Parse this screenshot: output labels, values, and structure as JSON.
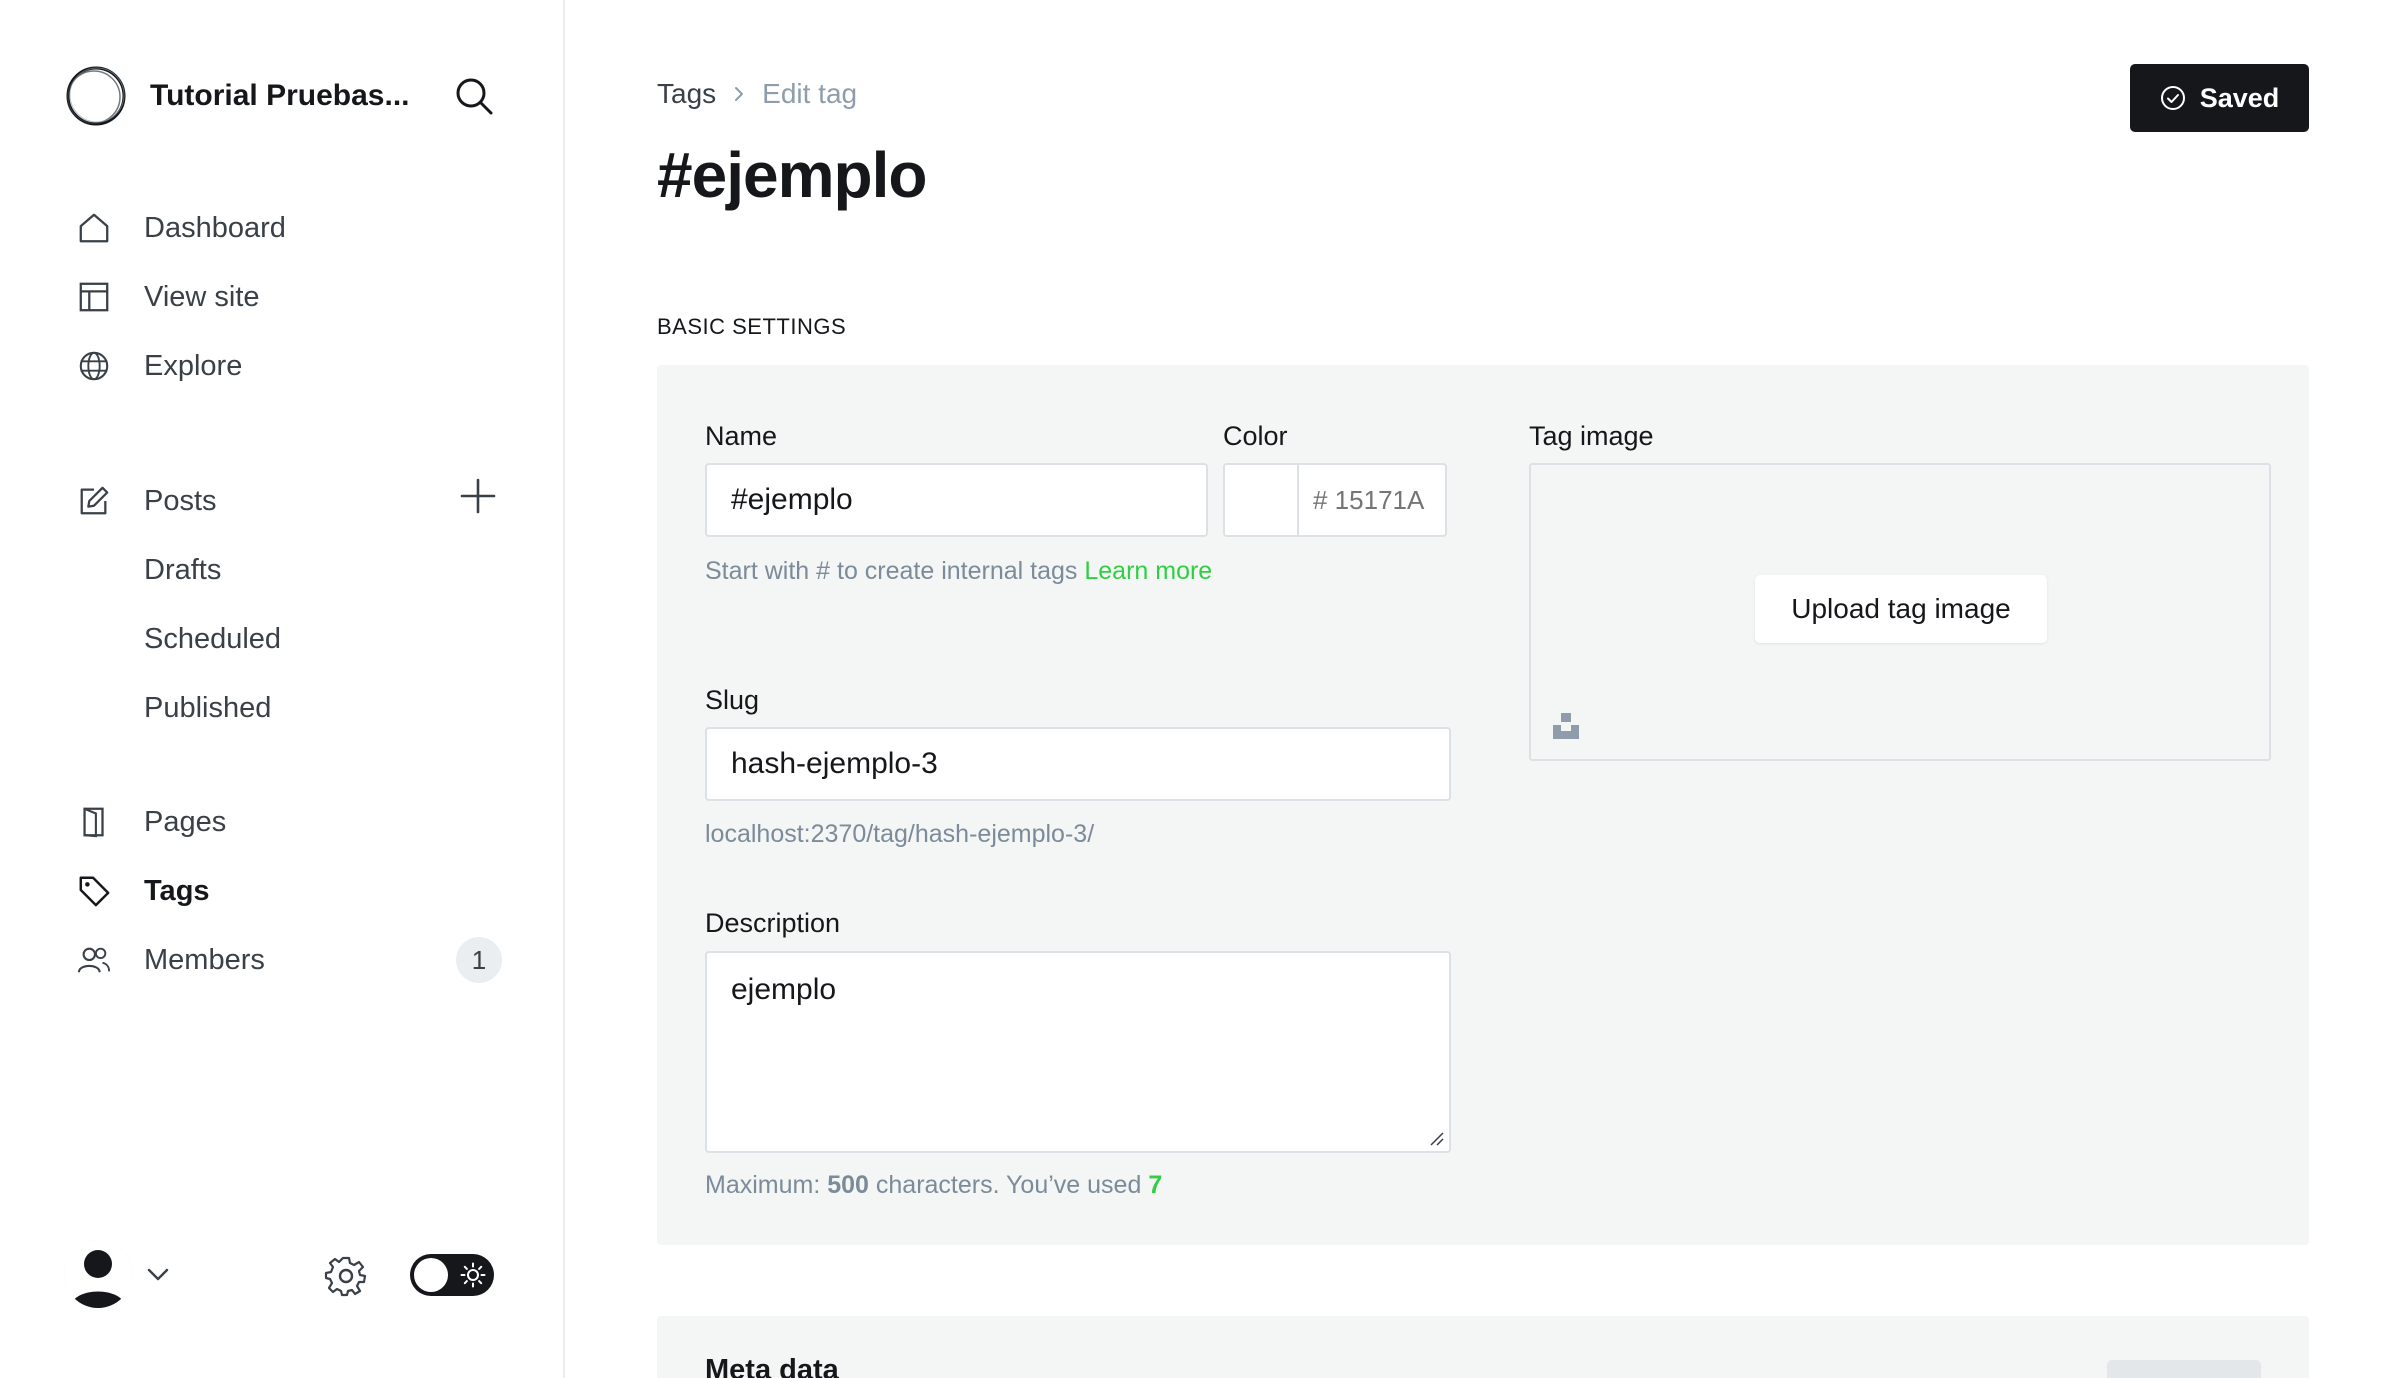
{
  "sidebar": {
    "site_title": "Tutorial Pruebas...",
    "nav": {
      "dashboard": "Dashboard",
      "view_site": "View site",
      "explore": "Explore",
      "posts": "Posts",
      "drafts": "Drafts",
      "scheduled": "Scheduled",
      "published": "Published",
      "pages": "Pages",
      "tags": "Tags",
      "members": "Members",
      "members_count": "1"
    },
    "active_item": "Tags"
  },
  "header": {
    "breadcrumb_parent": "Tags",
    "breadcrumb_current": "Edit tag",
    "title": "#ejemplo",
    "save_status": "Saved"
  },
  "basic_settings": {
    "section_title": "BASIC SETTINGS",
    "name_label": "Name",
    "name_value": "#ejemplo",
    "name_hint": "Start with # to create internal tags ",
    "name_hint_link": "Learn more",
    "color_label": "Color",
    "color_placeholder": "# 15171A",
    "slug_label": "Slug",
    "slug_value": "hash-ejemplo-3",
    "slug_url": "localhost:2370/tag/hash-ejemplo-3/",
    "description_label": "Description",
    "description_value": "ejemplo",
    "description_hint_prefix": "Maximum: ",
    "description_max": "500",
    "description_hint_mid": " characters. You’ve used ",
    "description_used": "7",
    "tag_image_label": "Tag image",
    "upload_label": "Upload tag image"
  },
  "meta_data": {
    "title": "Meta data"
  },
  "colors": {
    "accent": "#30cf43",
    "primary_dark": "#15171a",
    "panel_bg": "#f4f5f5"
  }
}
